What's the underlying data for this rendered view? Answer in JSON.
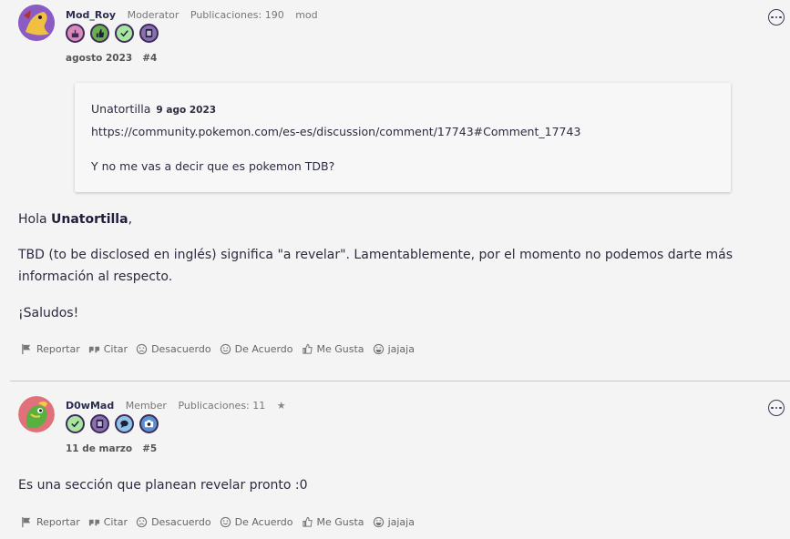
{
  "post4": {
    "author": "Mod_Roy",
    "role": "Moderator",
    "posts": "Publicaciones: 190",
    "tag": "mod",
    "date": "agosto 2023",
    "number": "#4",
    "badges": [
      "cake-icon",
      "thumbs-up-icon",
      "check-icon",
      "pokeball-icon"
    ],
    "quote": {
      "author": "Unatortilla",
      "date": "9 ago 2023",
      "link": "https://community.pokemon.com/es-es/discussion/comment/17743#Comment_17743",
      "text": "Y no me vas a decir que es pokemon TDB?"
    },
    "greeting_prefix": "Hola ",
    "greeting_name": "Unatortilla",
    "greeting_suffix": ",",
    "paragraph": "TBD (to be disclosed en inglés) significa \"a revelar\". Lamentablemente, por el momento no podemos darte más información al respecto.",
    "closing": "¡Saludos!"
  },
  "post5": {
    "author": "D0wMad",
    "role": "Member",
    "posts": "Publicaciones: 11",
    "star": "★",
    "date": "11 de marzo",
    "number": "#5",
    "badges": [
      "check-icon",
      "pokeball-icon",
      "speech-icon",
      "camera-icon"
    ],
    "text": "Es una sección que planean revelar pronto :0"
  },
  "reactions": {
    "report": "Reportar",
    "quote": "Citar",
    "disagree": "Desacuerdo",
    "agree": "De Acuerdo",
    "like": "Me Gusta",
    "lol": "jajaja"
  },
  "colors": {
    "badge_cake": "#d98ab8",
    "badge_thumb": "#6ab04c",
    "badge_check": "#a8e6a0",
    "badge_poke": "#8b6fb0",
    "badge_speech": "#8fc4e8",
    "badge_camera": "#5a8fd0"
  }
}
